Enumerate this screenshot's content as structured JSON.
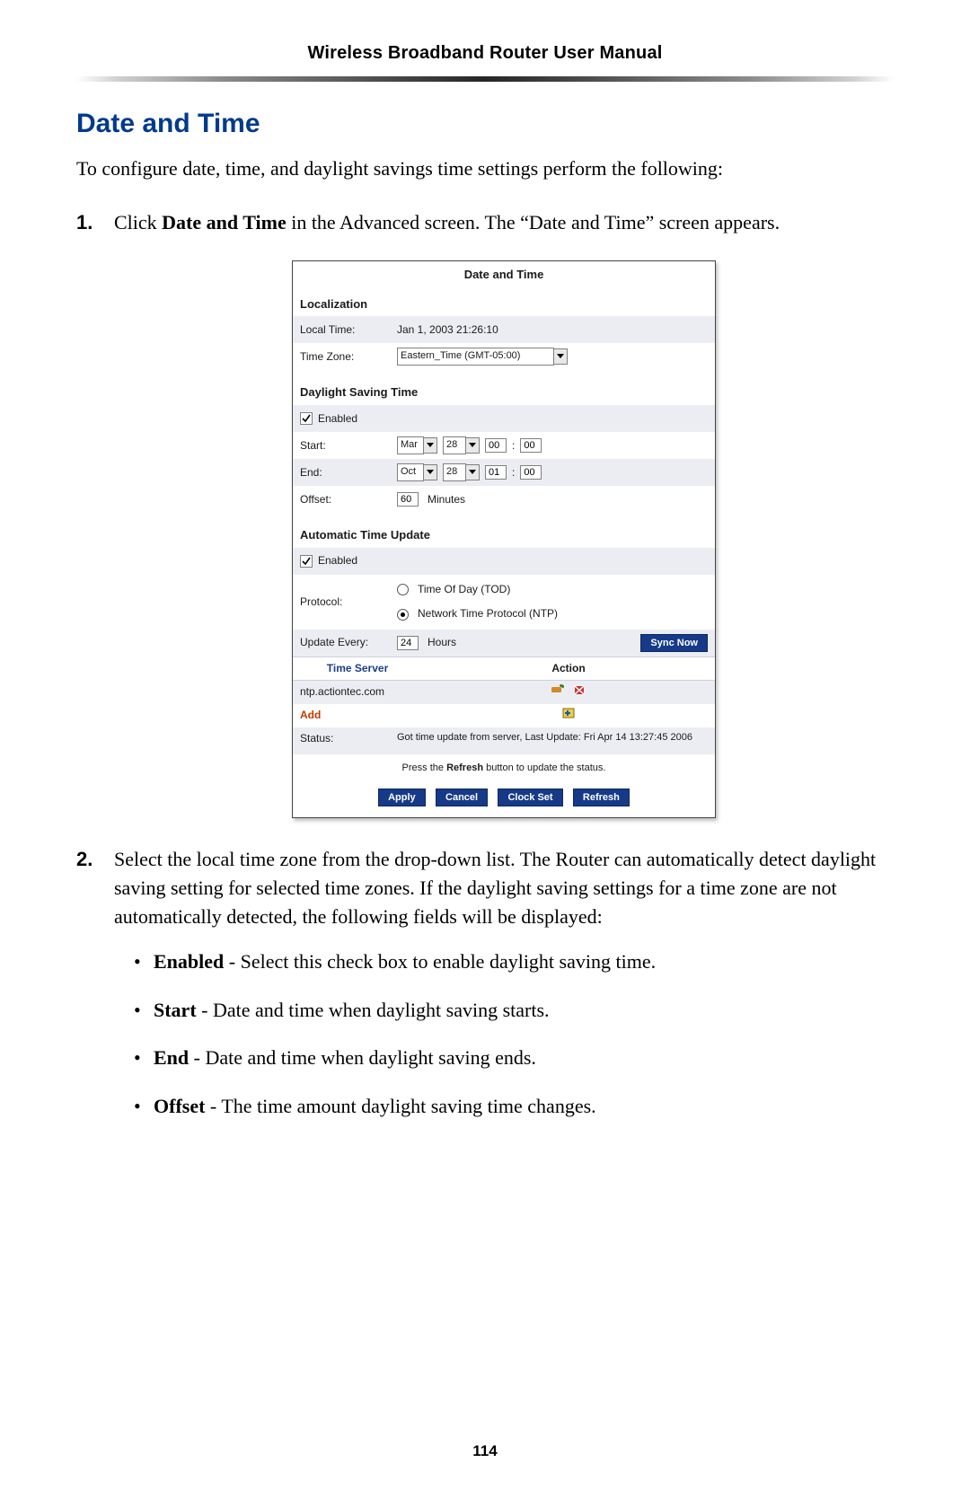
{
  "header": "Wireless Broadband Router User Manual",
  "h1": "Date and Time",
  "intro": "To configure date, time, and daylight savings time settings perform the following:",
  "steps": {
    "s1a": "Click ",
    "s1b": "Date and Time",
    "s1c": " in the Advanced screen. The “Date and Time” screen appears.",
    "s2": "Select the local time zone from the drop-down list. The Router can automatically detect daylight saving setting for selected time zones. If the daylight saving settings for a time zone are not automatically detected, the following fields will be displayed:"
  },
  "bullets": {
    "enabled_b": "Enabled",
    "enabled_t": " - Select this check box to enable daylight saving time.",
    "start_b": "Start",
    "start_t": " - Date and time when daylight saving starts.",
    "end_b": "End",
    "end_t": " - Date and time when daylight saving ends.",
    "offset_b": "Offset",
    "offset_t": " - The time amount daylight saving time changes."
  },
  "shot": {
    "title": "Date and Time",
    "loc_hdr": "Localization",
    "local_time_lbl": "Local Time:",
    "local_time_val": "Jan 1, 2003 21:26:10",
    "tz_lbl": "Time Zone:",
    "tz_val": "Eastern_Time (GMT-05:00)",
    "dst_hdr": "Daylight Saving Time",
    "enabled_lbl": "Enabled",
    "start_lbl": "Start:",
    "start_month": "Mar",
    "start_day": "28",
    "start_h": "00",
    "start_m": "00",
    "end_lbl": "End:",
    "end_month": "Oct",
    "end_day": "28",
    "end_h": "01",
    "end_m": "00",
    "offset_lbl": "Offset:",
    "offset_val": "60",
    "offset_unit": "Minutes",
    "atu_hdr": "Automatic Time Update",
    "protocol_lbl": "Protocol:",
    "proto_tod": "Time Of Day (TOD)",
    "proto_ntp": "Network Time Protocol (NTP)",
    "update_lbl": "Update Every:",
    "update_val": "24",
    "update_unit": "Hours",
    "sync_btn": "Sync Now",
    "th_server": "Time Server",
    "th_action": "Action",
    "server1": "ntp.actiontec.com",
    "add": "Add",
    "status_lbl": "Status:",
    "status_val": "Got time update from server, Last Update: Fri Apr 14 13:27:45 2006",
    "note_a": "Press the ",
    "note_b": "Refresh",
    "note_c": " button to update the status.",
    "apply": "Apply",
    "cancel": "Cancel",
    "clockset": "Clock Set",
    "refresh": "Refresh"
  },
  "page": "114"
}
